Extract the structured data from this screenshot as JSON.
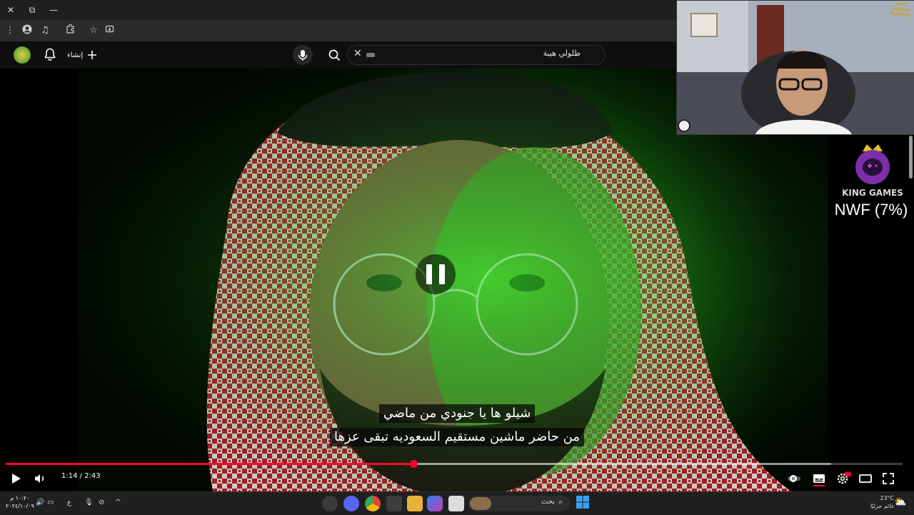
{
  "browser": {
    "window_controls": {
      "close": "✕",
      "restore": "⧉",
      "minimize": "—"
    }
  },
  "youtube": {
    "search": {
      "query": "طلولي هيبة"
    },
    "create_label": "إنشاء"
  },
  "player": {
    "subtitle_line1": "شيلو ها يا جنودي من ماضي",
    "subtitle_line2": "من حاضر ماشين مستقيم السعوديه تبقى عزها",
    "current_time": "1:14",
    "separator": " / ",
    "duration": "2:43",
    "played_fraction": 0.455,
    "buffered_fraction": 0.92,
    "state_indicator": "pause-icon"
  },
  "overlay": {
    "brand_name": "KING GAMES",
    "webcam_watermark": "KING NAWAF ALHAZMI",
    "stat": "NWF (7%)"
  },
  "taskbar": {
    "clock_time": "١٠:٢٠ م",
    "clock_date": "٢٠٢٤/١٠/٠٩",
    "lang": "ع",
    "search_placeholder": "بحث",
    "weather_temp": "23°C",
    "weather_text": "غائم جزئيًا"
  },
  "colors": {
    "progress": "#ff0033",
    "youtube_bg": "#0f0f0f",
    "overlay_purple": "#7b2fa8"
  }
}
